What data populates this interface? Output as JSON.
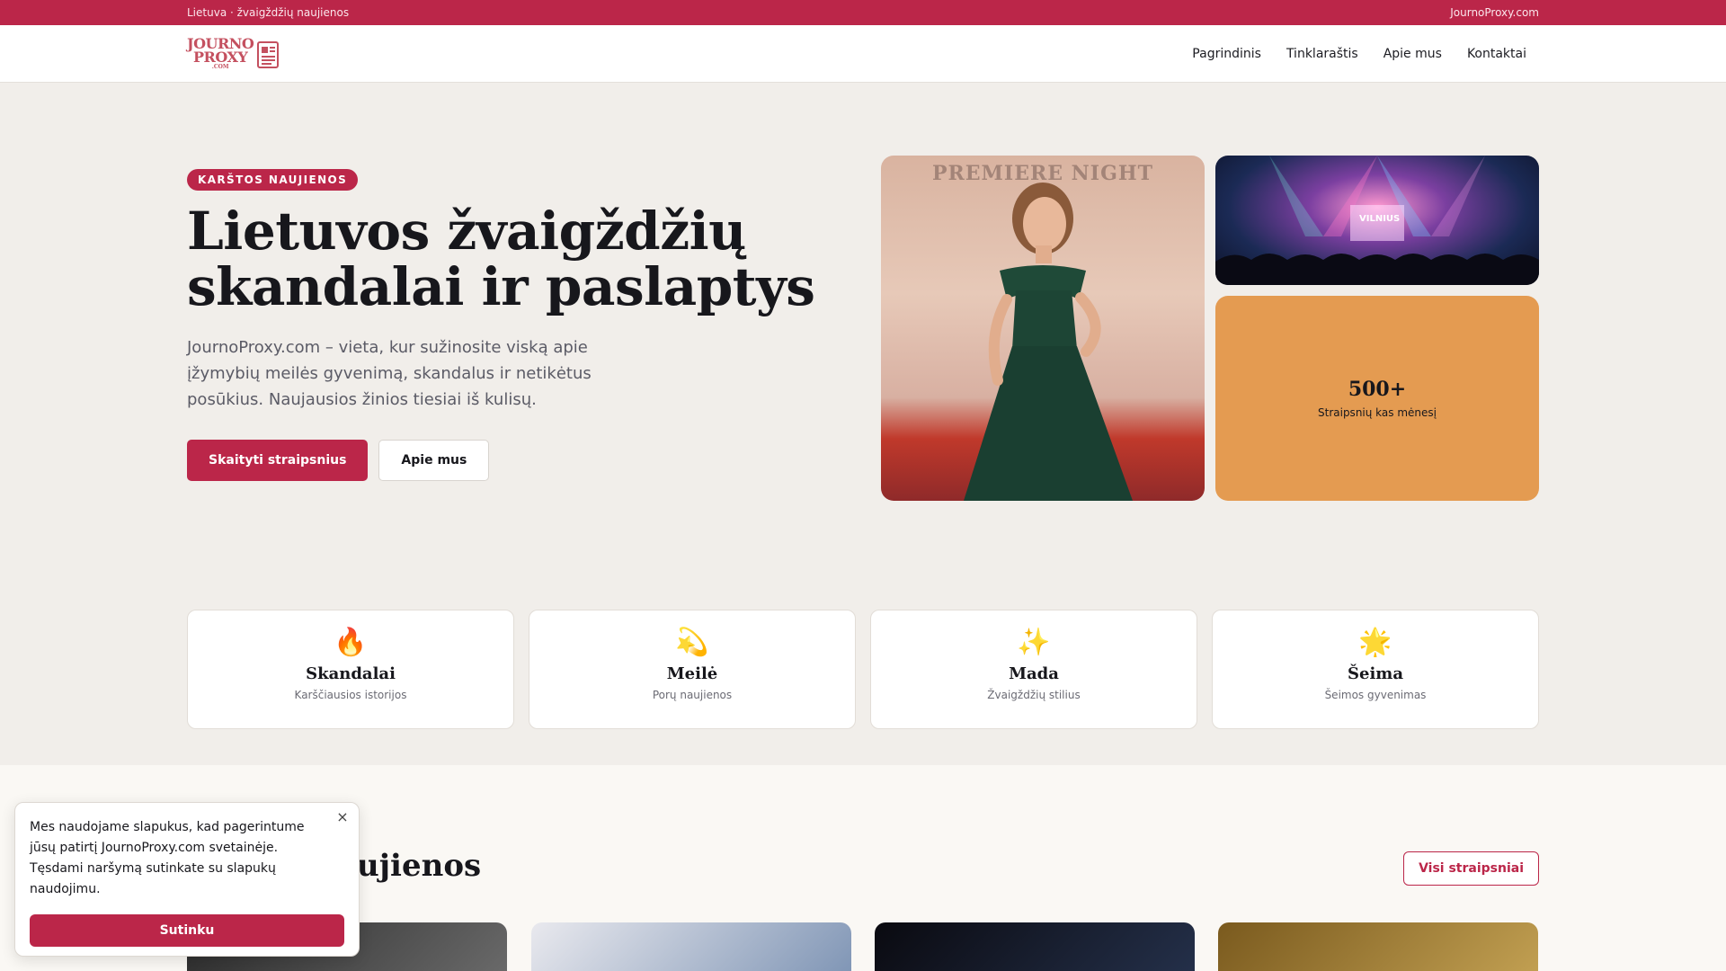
{
  "topbar": {
    "left": "Lietuva · žvaigždžių naujienos",
    "right": "JournoProxy.com"
  },
  "logo": {
    "line1": "JOURNO",
    "line2": "PROXY",
    "line3": ".COM"
  },
  "nav": {
    "items": [
      "Pagrindinis",
      "Tinklaraštis",
      "Apie mus",
      "Kontaktai"
    ]
  },
  "hero": {
    "badge": "KARŠTOS NAUJIENOS",
    "title_line1": "Lietuvos žvaigždžių",
    "title_line2": "skandalai ir paslaptys",
    "description": "JournoProxy.com – vieta, kur sužinosite viską apie įžymybių meilės gyvenimą, skandalus ir netikėtus posūkius. Naujausios žinios tiesiai iš kulisų.",
    "primary_button": "Skaityti straipsnius",
    "secondary_button": "Apie mus",
    "image_banner_text": "PREMIERE NIGHT",
    "concert_text": "VILNIUS",
    "stat_number": "500+",
    "stat_label": "Straipsnių kas mėnesį"
  },
  "categories": [
    {
      "icon": "🔥",
      "icon_name": "fire-icon",
      "name": "Skandalai",
      "sub": "Karščiausios istorijos"
    },
    {
      "icon": "💫",
      "icon_name": "dizzy-star-icon",
      "name": "Meilė",
      "sub": "Porų naujienos"
    },
    {
      "icon": "✨",
      "icon_name": "sparkles-icon",
      "name": "Mada",
      "sub": "Žvaigždžių stilius"
    },
    {
      "icon": "🌟",
      "icon_name": "glowing-star-icon",
      "name": "Šeima",
      "sub": "Šeimos gyvenimas"
    }
  ],
  "latest": {
    "title_visible": "aujienos",
    "all_button": "Visi straipsniai"
  },
  "cookie": {
    "text": "Mes naudojame slapukus, kad pagerintume jūsų patirtį JournoProxy.com svetainėje. Tęsdami naršymą sutinkate su slapukų naudojimu.",
    "close_label": "×",
    "accept_button": "Sutinku"
  },
  "colors": {
    "accent": "#bb2649",
    "stat_tile": "#e49b51",
    "background": "#f1eeea"
  }
}
